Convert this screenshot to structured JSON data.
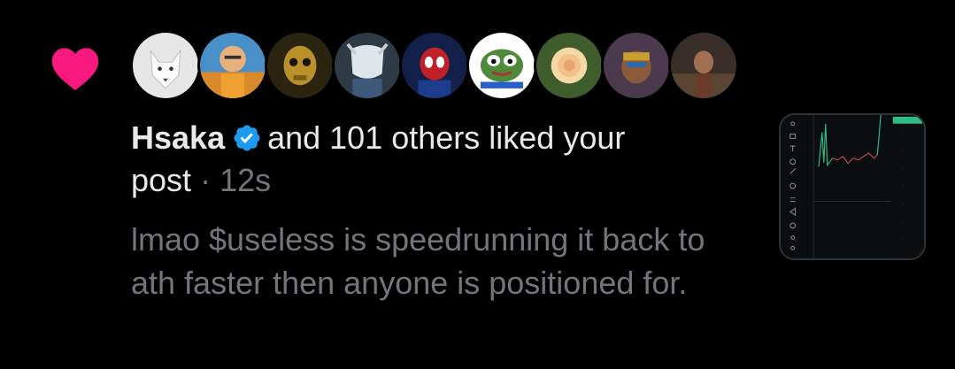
{
  "notification": {
    "icon": "heart-icon",
    "accent_color": "#f91880",
    "avatars": [
      {
        "name": "white-wolf-avatar"
      },
      {
        "name": "cartoon-man-avatar"
      },
      {
        "name": "gold-skull-avatar"
      },
      {
        "name": "polar-bear-avatar"
      },
      {
        "name": "spiderman-avatar"
      },
      {
        "name": "pepe-frog-avatar"
      },
      {
        "name": "rose-avatar"
      },
      {
        "name": "ape-avatar"
      },
      {
        "name": "street-avatar"
      }
    ],
    "user_name": "Hsaka",
    "verified_color": "#1d9bf0",
    "action_text": "and 101 others liked your",
    "action_text_2": "post",
    "separator": "·",
    "time": "12s",
    "post_text": "lmao $useless is speedrunning it back to ath faster then anyone is positioned for.",
    "thumbnail": "chart-screenshot-thumbnail"
  }
}
